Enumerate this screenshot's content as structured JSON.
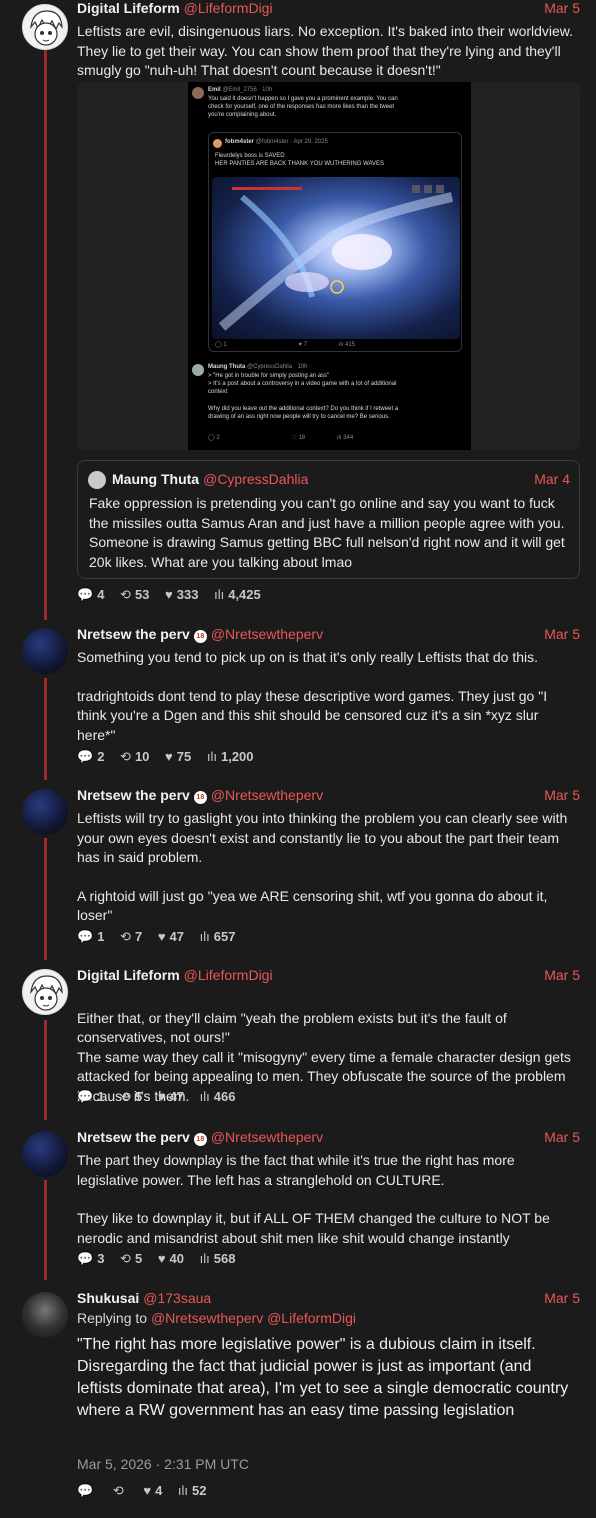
{
  "tweets": [
    {
      "name": "Digital Lifeform",
      "handle": "@LifeformDigi",
      "date": "Mar 5",
      "body": [
        "Leftists are evil, disingenuous liars. No exception. It's baked into their worldview. They lie to get their way. You can show them proof that they're lying and they'll smugly go \"nuh-uh! That doesn't count because it doesn't!\""
      ],
      "stats": {
        "replies": "4",
        "retweets": "53",
        "likes": "333",
        "views": "4,425"
      }
    },
    {
      "name": "Nretsew the perv",
      "badge": "18",
      "handle": "@Nretsewtheperv",
      "date": "Mar 5",
      "body": [
        "Something you tend to pick up on is that it's only really Leftists that do this.",
        "tradrightoids dont tend to play these descriptive word games. They just go \"I think you're a Dgen and this shit should be censored cuz it's a sin *xyz slur here*\""
      ],
      "stats": {
        "replies": "2",
        "retweets": "10",
        "likes": "75",
        "views": "1,200"
      }
    },
    {
      "name": "Nretsew the perv",
      "badge": "18",
      "handle": "@Nretsewtheperv",
      "date": "Mar 5",
      "body": [
        "Leftists will try to gaslight you into thinking the problem you can clearly see with your own eyes doesn't exist and constantly lie to you about the part their team has in said problem.",
        "A rightoid will just go \"yea we ARE censoring shit, wtf you gonna do about it, loser\""
      ],
      "stats": {
        "replies": "1",
        "retweets": "7",
        "likes": "47",
        "views": "657"
      }
    },
    {
      "name": "Digital Lifeform",
      "handle": "@LifeformDigi",
      "date": "Mar 5",
      "body": [
        "Either that, or they'll claim \"yeah the problem exists but it's the fault of conservatives, not ours!\"\nThe same way they call it \"misogyny\" every time a female character design gets attacked for being appealing to men. They obfuscate the source of the problem because it's them."
      ],
      "stats": {
        "replies": "1",
        "retweets": "5",
        "likes": "47",
        "views": "466"
      }
    },
    {
      "name": "Nretsew the perv",
      "badge": "18",
      "handle": "@Nretsewtheperv",
      "date": "Mar 5",
      "body": [
        "The part they downplay is the fact that while it's true the right has more legislative power. The left has a stranglehold on CULTURE.",
        "They like to downplay it, but if ALL OF THEM changed the culture to NOT be nerodic and misandrist about shit men like shit would change instantly"
      ],
      "stats": {
        "replies": "3",
        "retweets": "5",
        "likes": "40",
        "views": "568"
      }
    },
    {
      "name": "Shukusai",
      "handle": "@173saua",
      "date": "Mar 5",
      "replying_label": "Replying to",
      "replying_handles": "@Nretsewtheperv @LifeformDigi",
      "body": [
        "\"The right has more legislative power\" is a dubious claim in itself. Disregarding the fact that judicial power is just as important (and leftists dominate that area), I'm yet to see a single democratic country where a RW government has an easy time passing legislation"
      ],
      "timestamp": "Mar 5, 2026 · 2:31 PM UTC",
      "stats": {
        "likes": "4",
        "views": "52"
      }
    }
  ],
  "quote": {
    "name": "Maung Thuta",
    "handle": "@CypressDahlia",
    "date": "Mar 4",
    "body": "Fake oppression is pretending you can't go online and say you want to fuck the missiles outta Samus Aran and just have a million people agree with you. Someone is drawing Samus getting BBC full nelson'd right now and it will get 20k likes. What are you talking about lmao"
  },
  "embedded_screenshot": {
    "top_name": "Emil",
    "top_handle": "@Emil_2756 · 10h",
    "top_text": [
      "You said it doesn't happen so I gave you a prominent example. You can",
      "check for yourself, one of the responses has more likes than the tweet",
      "you're complaining about."
    ],
    "inner_name": "fobm4ster",
    "inner_handle": "@fobm4ster · Apr 29, 2025",
    "inner_text": [
      "Fleurdelys boss is SAVED",
      "HER PANTIES ARE BACK THANK YOU WUTHERING WAVES"
    ],
    "inner_stats": {
      "replies": "1",
      "likes": "7",
      "views": "415"
    },
    "reply_name": "Maung Thuta",
    "reply_handle": "@CypressDahlia · 10h",
    "reply_text": [
      "> \"He got in trouble for simply posting an ass\"",
      "> It's a post about a controversy in a video game with a lot of additional",
      "context",
      "",
      "Why did you leave out the additional context? Do you think if I retweet a",
      "drawing of an ass right now people will try to cancel me? Be serious."
    ],
    "reply_stats": {
      "replies": "2",
      "likes": "18",
      "views": "344"
    }
  },
  "icons": {
    "reply": "reply-icon",
    "retweet": "retweet-icon",
    "like": "heart-icon",
    "views": "views-icon"
  },
  "colors": {
    "background": "#1b1b1b",
    "accent": "#e95757",
    "thread_line": "#9b2a2a"
  }
}
